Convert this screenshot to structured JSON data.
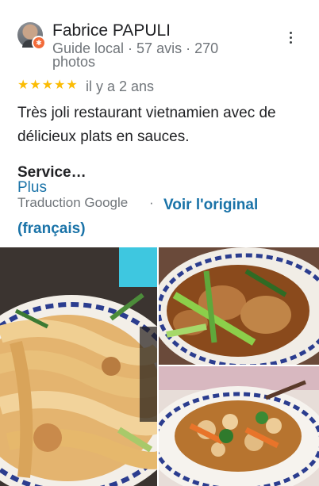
{
  "review": {
    "author": "Fabrice PAPULI",
    "author_meta": "Guide local · 57 avis · 270 photos",
    "rating": 5,
    "time_ago": "il y a 2 ans",
    "text": "Très joli restaurant vietnamien avec de délicieux plats en sauces.",
    "service_label": "Service…",
    "more_label": "Plus",
    "translation_label": "Traduction Google",
    "separator": "·",
    "original_link": "Voir l'original (français)"
  },
  "colors": {
    "star": "#fbbc04",
    "link": "#1a73a8",
    "secondary_text": "#70757a",
    "badge": "#f26b3a"
  },
  "icons": {
    "avatar_badge": "local-guide-badge-icon",
    "menu": "more-vert-icon",
    "rating": "star-icon"
  }
}
